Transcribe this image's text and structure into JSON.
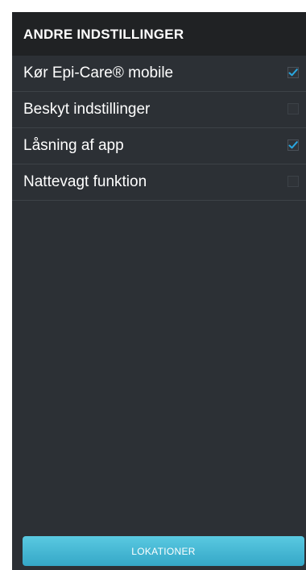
{
  "header": {
    "title": "ANDRE INDSTILLINGER"
  },
  "settings": [
    {
      "label": "Kør Epi-Care® mobile",
      "checked": true
    },
    {
      "label": "Beskyt indstillinger",
      "checked": false
    },
    {
      "label": "Låsning af app",
      "checked": true
    },
    {
      "label": "Nattevagt funktion",
      "checked": false
    }
  ],
  "footer": {
    "button_label": "LOKATIONER"
  },
  "colors": {
    "panel_bg": "#2c3035",
    "header_bg": "#202224",
    "check_accent": "#2aa7e0",
    "button_accent": "#4ab9d6"
  },
  "icons": {
    "checked": "checkmark-icon",
    "unchecked": "empty-checkbox-icon"
  }
}
